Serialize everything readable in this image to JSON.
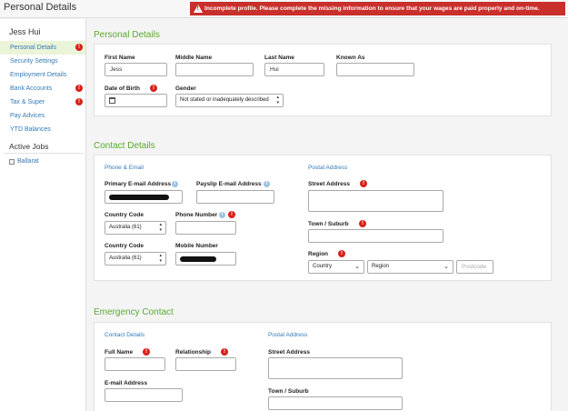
{
  "header": {
    "title": "Personal Details"
  },
  "alert": {
    "text": "Incomplete profile. Please complete the missing information to ensure that your wages are paid properly and on-time."
  },
  "sidebar": {
    "user": "Jess Hui",
    "items": [
      {
        "label": "Personal Details"
      },
      {
        "label": "Security Settings"
      },
      {
        "label": "Employment Details"
      },
      {
        "label": "Bank Accounts"
      },
      {
        "label": "Tax & Super"
      },
      {
        "label": "Pay Advices"
      },
      {
        "label": "YTD Balances"
      }
    ],
    "jobs_title": "Active Jobs",
    "job": "Ballarat"
  },
  "personal": {
    "title": "Personal Details",
    "first_name_label": "First Name",
    "first_name_value": "Jess",
    "middle_name_label": "Middle Name",
    "last_name_label": "Last Name",
    "last_name_value": "Hui",
    "known_as_label": "Known As",
    "dob_label": "Date of Birth",
    "gender_label": "Gender",
    "gender_value": "Not stated or inadequately described"
  },
  "contact": {
    "title": "Contact Details",
    "phone_email_title": "Phone & Email",
    "primary_email_label": "Primary E-mail Address",
    "payslip_email_label": "Payslip E-mail Address",
    "country_code_label": "Country Code",
    "country_code_value": "Australia (61)",
    "phone_label": "Phone Number",
    "country_code2_label": "Country Code",
    "country_code2_value": "Australia (61)",
    "mobile_label": "Mobile Number",
    "postal_title": "Postal Address",
    "street_label": "Street Address",
    "town_label": "Town / Suburb",
    "region_label": "Region",
    "country_select": "Country",
    "region_select": "Region",
    "postcode_placeholder": "Postcode"
  },
  "emergency": {
    "title": "Emergency Contact",
    "contact_title": "Contact Details",
    "full_name_label": "Full Name",
    "relationship_label": "Relationship",
    "email_label": "E-mail Address",
    "postal_title": "Postal Address",
    "street_label": "Street Address",
    "town_label": "Town / Suburb"
  },
  "colors": {
    "accent_green": "#5cab2e",
    "link_blue": "#337ab7",
    "error_red": "#d9201a",
    "alert_red": "#c9302c"
  }
}
